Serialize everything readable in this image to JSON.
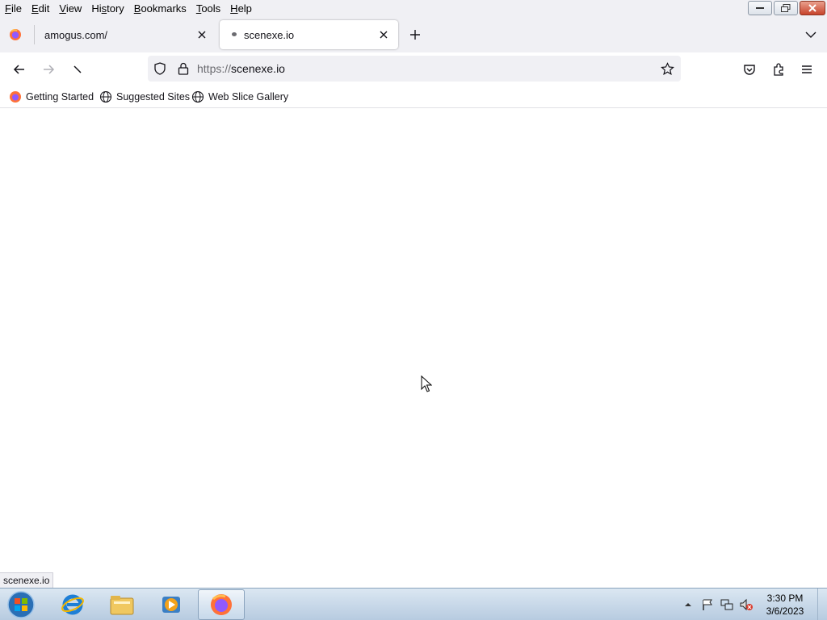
{
  "menubar": {
    "items": [
      {
        "pre": "",
        "ul": "F",
        "post": "ile"
      },
      {
        "pre": "",
        "ul": "E",
        "post": "dit"
      },
      {
        "pre": "",
        "ul": "V",
        "post": "iew"
      },
      {
        "pre": "Hi",
        "ul": "s",
        "post": "tory"
      },
      {
        "pre": "",
        "ul": "B",
        "post": "ookmarks"
      },
      {
        "pre": "",
        "ul": "T",
        "post": "ools"
      },
      {
        "pre": "",
        "ul": "H",
        "post": "elp"
      }
    ]
  },
  "tabs": [
    {
      "title": "amogus.com/",
      "active": false
    },
    {
      "title": "scenexe.io",
      "active": true
    }
  ],
  "urlbar": {
    "protocol": "https://",
    "host": "scenexe.io"
  },
  "bookmarks": [
    {
      "label": "Getting Started",
      "icon": "firefox-icon"
    },
    {
      "label": "Suggested Sites",
      "icon": "globe-icon"
    },
    {
      "label": "Web Slice Gallery",
      "icon": "globe-icon"
    }
  ],
  "status_text": "scenexe.io",
  "taskbar": {
    "apps": [
      "internet-explorer-icon",
      "file-explorer-icon",
      "media-player-icon",
      "firefox-icon"
    ],
    "clock_time": "3:30 PM",
    "clock_date": "3/6/2023"
  },
  "colors": {
    "chrome_bg": "#f0f0f4",
    "taskbar_top": "#dbe7f2",
    "taskbar_bottom": "#b7cbe0"
  }
}
